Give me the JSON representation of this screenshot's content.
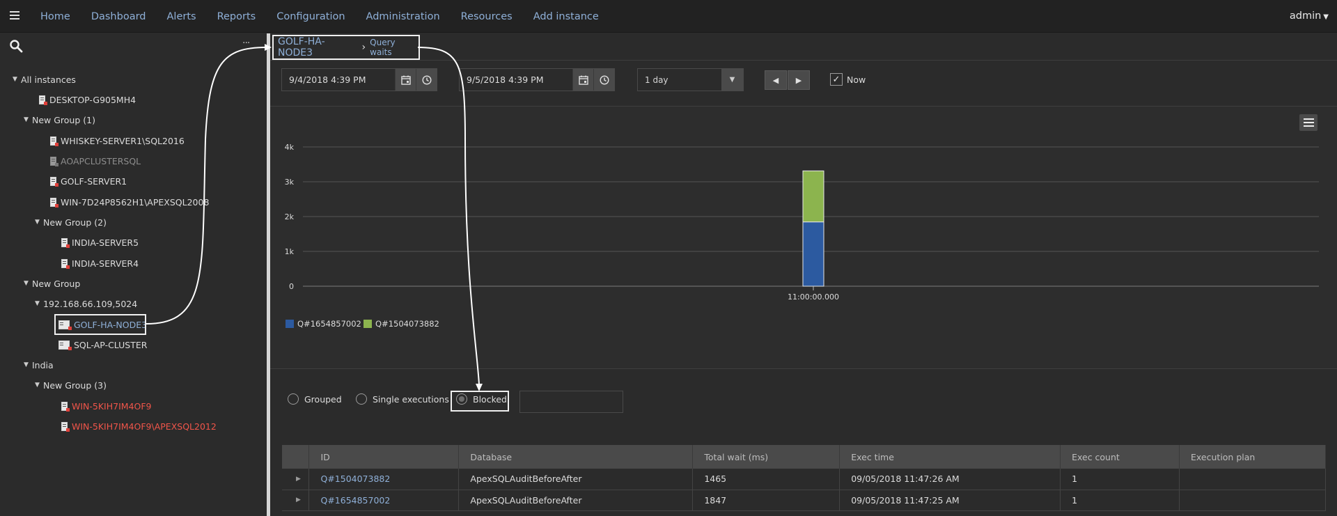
{
  "nav": {
    "items": [
      "Home",
      "Dashboard",
      "Alerts",
      "Reports",
      "Configuration",
      "Administration",
      "Resources",
      "Add instance"
    ],
    "user": "admin"
  },
  "sidebar": {
    "more": "···",
    "tree": {
      "root": "All instances",
      "desktop": "DESKTOP-G905MH4",
      "group1": "New Group (1)",
      "whiskey": "WHISKEY-SERVER1\\SQL2016",
      "aoap": "AOAPCLUSTERSQL",
      "golf1": "GOLF-SERVER1",
      "win7d": "WIN-7D24P8562H1\\APEXSQL2008",
      "group2": "New Group (2)",
      "india5": "INDIA-SERVER5",
      "india4": "INDIA-SERVER4",
      "newgroup": "New Group",
      "ipgroup": "192.168.66.109,5024",
      "node3": "GOLF-HA-NODE3",
      "sqlap": "SQL-AP-CLUSTER",
      "india": "India",
      "group3": "New Group (3)",
      "win5k": "WIN-5KIH7IM4OF9",
      "win5kapex": "WIN-5KIH7IM4OF9\\APEXSQL2012"
    }
  },
  "breadcrumb": {
    "instance": "GOLF-HA-NODE3",
    "separator": "›",
    "page": "Query waits"
  },
  "toolbar": {
    "start_date": "9/4/2018 4:39 PM",
    "end_date": "9/5/2018 4:39 PM",
    "period": "1 day",
    "now_label": "Now",
    "now_checked": true
  },
  "chart_data": {
    "type": "bar",
    "stacked": true,
    "categories": [
      "11:00:00.000"
    ],
    "series": [
      {
        "name": "Q#1654857002",
        "values": [
          1847
        ],
        "color": "#2c5aa0"
      },
      {
        "name": "Q#1504073882",
        "values": [
          1465
        ],
        "color": "#8cb44e"
      }
    ],
    "ylim": [
      0,
      4000
    ],
    "yticks": [
      0,
      1000,
      2000,
      3000,
      4000
    ],
    "ytick_labels": [
      "0",
      "1k",
      "2k",
      "3k",
      "4k"
    ],
    "grid": true,
    "legend": "bottom-left"
  },
  "filters": {
    "options": [
      "Grouped",
      "Single executions",
      "Blocked"
    ],
    "selected": "Blocked",
    "search_value": ""
  },
  "table": {
    "columns": [
      "",
      "ID",
      "Database",
      "Total wait (ms)",
      "Exec time",
      "Exec count",
      "Execution plan"
    ],
    "rows": [
      {
        "id": "Q#1504073882",
        "database": "ApexSQLAuditBeforeAfter",
        "total_wait": "1465",
        "exec_time": "09/05/2018 11:47:26 AM",
        "exec_count": "1",
        "plan": ""
      },
      {
        "id": "Q#1654857002",
        "database": "ApexSQLAuditBeforeAfter",
        "total_wait": "1847",
        "exec_time": "09/05/2018 11:47:25 AM",
        "exec_count": "1",
        "plan": ""
      }
    ]
  }
}
